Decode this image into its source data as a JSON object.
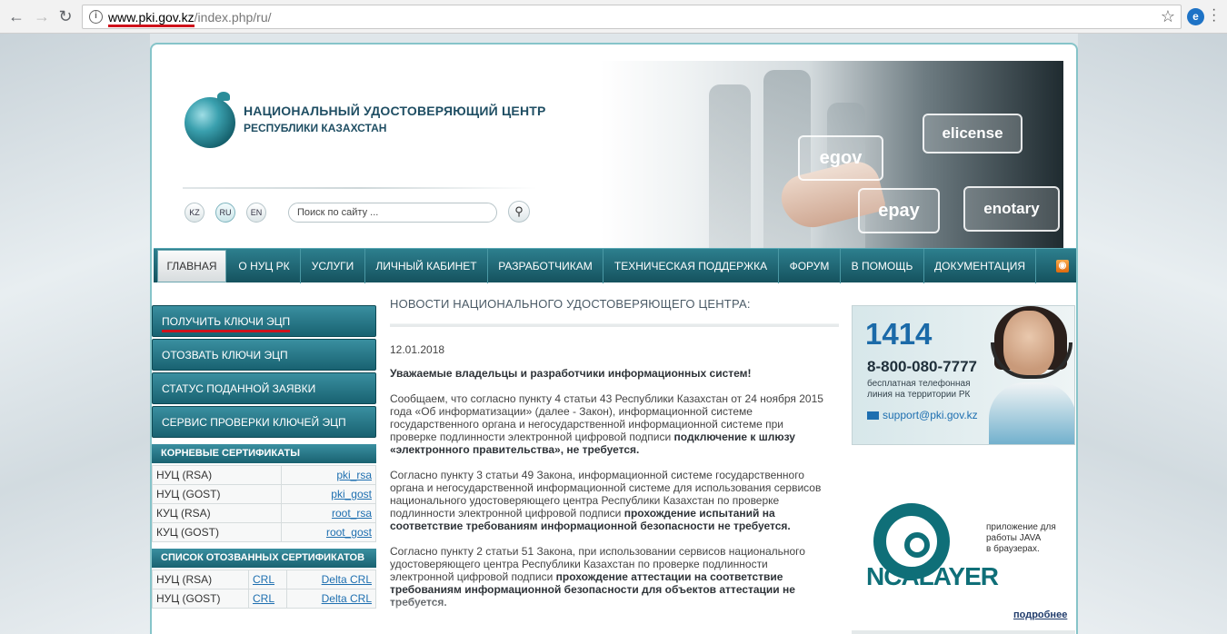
{
  "browser": {
    "url_domain": "www.pki.gov.kz",
    "url_path": "/index.php/ru/",
    "back": "←",
    "forward": "→",
    "reload": "↻",
    "star": "☆",
    "info": "i"
  },
  "header": {
    "title": "НАЦИОНАЛЬНЫЙ УДОСТОВЕРЯЮЩИЙ ЦЕНТР",
    "subtitle": "РЕСПУБЛИКИ КАЗАХСТАН",
    "languages": [
      "KZ",
      "RU",
      "EN"
    ],
    "active_language": "RU",
    "search_placeholder": "Поиск по сайту ...",
    "banner_tiles": [
      "egov",
      "elicense",
      "epay",
      "enotary"
    ]
  },
  "nav": {
    "items": [
      "ГЛАВНАЯ",
      "О НУЦ РК",
      "УСЛУГИ",
      "ЛИЧНЫЙ КАБИНЕТ",
      "РАЗРАБОТЧИКАМ",
      "ТЕХНИЧЕСКАЯ ПОДДЕРЖКА",
      "ФОРУМ",
      "В ПОМОЩЬ",
      "ДОКУМЕНТАЦИЯ"
    ],
    "active": "ГЛАВНАЯ",
    "rss_icon": "rss-icon"
  },
  "sidebar": {
    "buttons": [
      "ПОЛУЧИТЬ КЛЮЧИ ЭЦП",
      "ОТОЗВАТЬ КЛЮЧИ ЭЦП",
      "СТАТУС ПОДАННОЙ ЗАЯВКИ",
      "СЕРВИС ПРОВЕРКИ КЛЮЧЕЙ ЭЦП"
    ],
    "root_title": "КОРНЕВЫЕ СЕРТИФИКАТЫ",
    "root_rows": [
      {
        "name": "НУЦ (RSA)",
        "link": "pki_rsa"
      },
      {
        "name": "НУЦ (GOST)",
        "link": "pki_gost"
      },
      {
        "name": "КУЦ (RSA)",
        "link": "root_rsa"
      },
      {
        "name": "КУЦ (GOST)",
        "link": "root_gost"
      }
    ],
    "revoked_title": "СПИСОК ОТОЗВАННЫХ СЕРТИФИКАТОВ",
    "revoked_rows": [
      {
        "name": "НУЦ (RSA)",
        "crl": "CRL",
        "delta": "Delta CRL"
      },
      {
        "name": "НУЦ (GOST)",
        "crl": "CRL",
        "delta": "Delta CRL"
      }
    ]
  },
  "news": {
    "title": "НОВОСТИ НАЦИОНАЛЬНОГО УДОСТОВЕРЯЮЩЕГО ЦЕНТРА:",
    "date": "12.01.2018",
    "headline": "Уважаемые владельцы и разработчики информационных систем!",
    "p1_text": "Сообщаем, что согласно пункту 4 статьи 43 Республики Казахстан от 24 ноября 2015 года «Об информатизации» (далее - Закон), информационной системе государственного органа и негосударственной информационной системе при проверке подлинности электронной цифровой подписи ",
    "p1_bold": "подключение к шлюзу «электронного правительства», не требуется.",
    "p2_text": "Согласно пункту 3 статьи 49 Закона, информационной системе государственного органа и негосударственной информационной системе для использования сервисов национального удостоверяющего центра Республики Казахстан по проверке подлинности электронной цифровой подписи ",
    "p2_bold": "прохождение испытаний на соответствие требованиям информационной безопасности не требуется.",
    "p3_text": "Согласно пункту 2 статьи 51 Закона, при использовании сервисов национального удостоверяющего центра Республики Казахстан по проверке подлинности электронной цифровой подписи ",
    "p3_bold": "прохождение аттестации на соответствие требованиям информационной безопасности для объектов аттестации не требуется."
  },
  "hotline": {
    "number": "1414",
    "phone": "8-800-080-7777",
    "desc1": "бесплатная телефонная",
    "desc2": "линия на территории РК",
    "email": "support@pki.gov.kz"
  },
  "ncalayer": {
    "logo": "NCALAYER",
    "desc1": "приложение для",
    "desc2": "работы JAVA",
    "desc3": "в браузерах.",
    "more": "подробнее"
  }
}
